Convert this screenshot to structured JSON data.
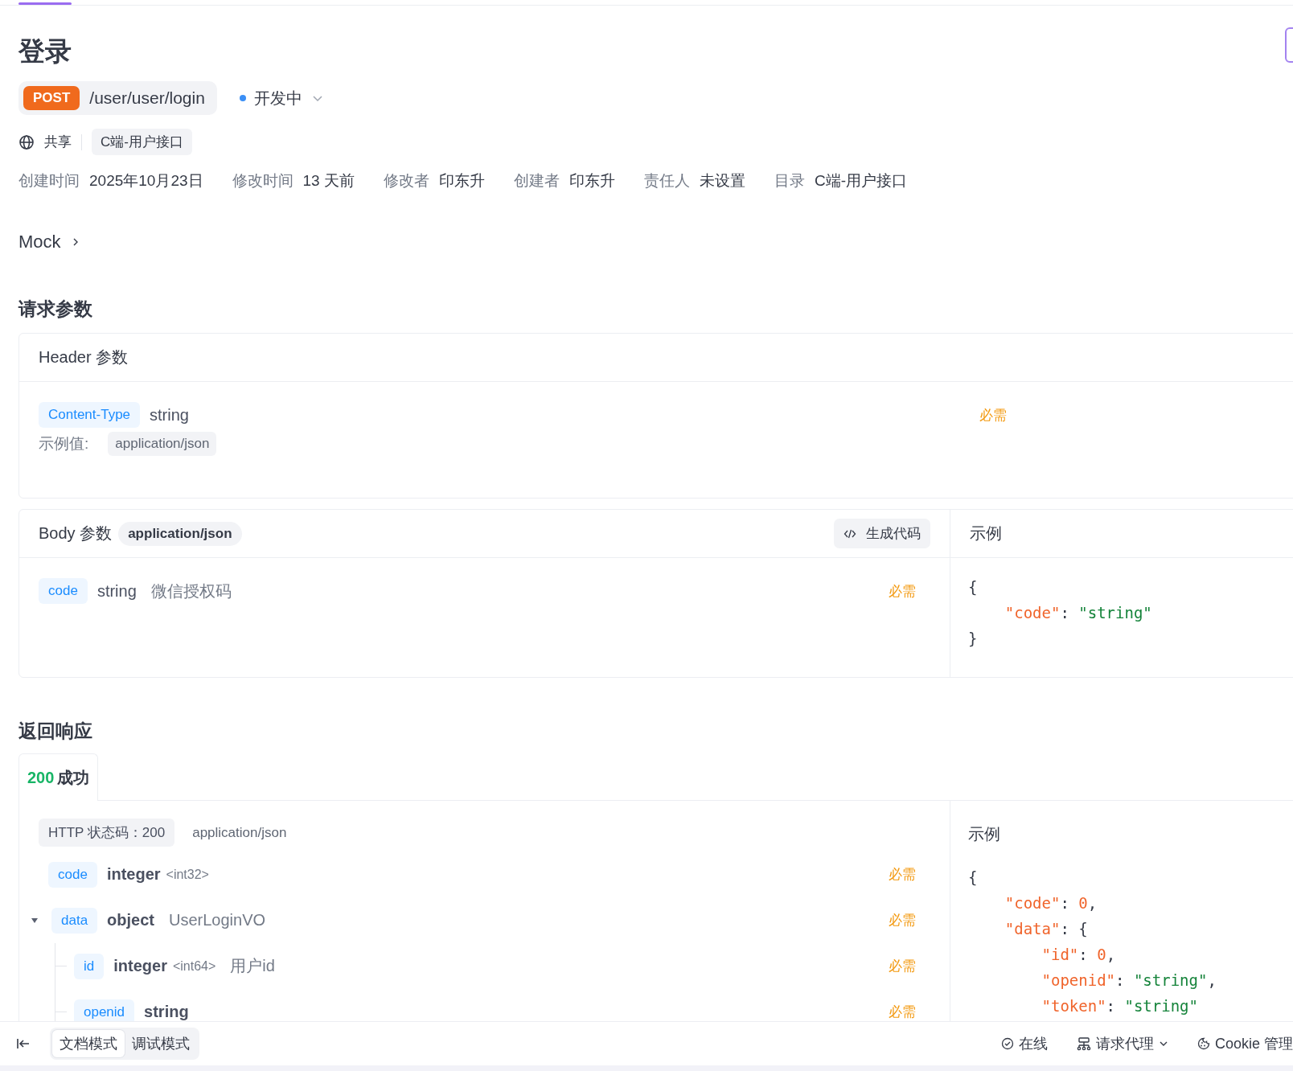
{
  "title": "登录",
  "method": "POST",
  "path": "/user/user/login",
  "status": {
    "label": "开发中",
    "color": "#3b8ff6"
  },
  "share": "共享",
  "folder_tag": "C端-用户接口",
  "meta": [
    {
      "label": "创建时间",
      "value": "2025年10月23日"
    },
    {
      "label": "修改时间",
      "value": "13 天前"
    },
    {
      "label": "修改者",
      "value": "印东升"
    },
    {
      "label": "创建者",
      "value": "印东升"
    },
    {
      "label": "责任人",
      "value": "未设置"
    },
    {
      "label": "目录",
      "value": "C端-用户接口"
    }
  ],
  "mock": {
    "label": "Mock",
    "expanded": false
  },
  "request": {
    "title": "请求参数",
    "header": {
      "title": "Header 参数",
      "params": [
        {
          "name": "Content-Type",
          "type": "string",
          "required": "必需",
          "example_label": "示例值:",
          "example": "application/json"
        }
      ]
    },
    "body": {
      "title": "Body 参数",
      "content_type": "application/json",
      "generate_button": "生成代码",
      "example_title": "示例",
      "params": [
        {
          "name": "code",
          "type": "string",
          "description": "微信授权码",
          "required": "必需"
        }
      ],
      "example": [
        [
          {
            "kind": "punct",
            "text": "{"
          }
        ],
        [
          {
            "kind": "key",
            "text": "    \"code\""
          },
          {
            "kind": "punct",
            "text": ": "
          },
          {
            "kind": "string",
            "text": "\"string\""
          }
        ],
        [
          {
            "kind": "punct",
            "text": "}"
          }
        ]
      ]
    }
  },
  "response": {
    "title": "返回响应",
    "tabs": [
      {
        "code": "200",
        "label": "成功",
        "selected": true
      }
    ],
    "http_status": "HTTP 状态码：200",
    "content_type": "application/json",
    "example_title": "示例",
    "fields": [
      {
        "name": "code",
        "type": "integer",
        "format": "<int32>",
        "required": "必需"
      },
      {
        "name": "data",
        "type": "object",
        "description": "UserLoginVO",
        "required": "必需",
        "expanded": true,
        "children": [
          {
            "name": "id",
            "type": "integer",
            "format": "<int64>",
            "description": "用户id",
            "required": "必需"
          },
          {
            "name": "openid",
            "type": "string",
            "required": "必需"
          }
        ]
      }
    ],
    "example": [
      [
        {
          "kind": "punct",
          "text": "{"
        }
      ],
      [
        {
          "kind": "key",
          "text": "    \"code\""
        },
        {
          "kind": "punct",
          "text": ": "
        },
        {
          "kind": "number",
          "text": "0"
        },
        {
          "kind": "punct",
          "text": ","
        }
      ],
      [
        {
          "kind": "key",
          "text": "    \"data\""
        },
        {
          "kind": "punct",
          "text": ": {"
        }
      ],
      [
        {
          "kind": "key",
          "text": "        \"id\""
        },
        {
          "kind": "punct",
          "text": ": "
        },
        {
          "kind": "number",
          "text": "0"
        },
        {
          "kind": "punct",
          "text": ","
        }
      ],
      [
        {
          "kind": "key",
          "text": "        \"openid\""
        },
        {
          "kind": "punct",
          "text": ": "
        },
        {
          "kind": "string",
          "text": "\"string\""
        },
        {
          "kind": "punct",
          "text": ","
        }
      ],
      [
        {
          "kind": "key",
          "text": "        \"token\""
        },
        {
          "kind": "punct",
          "text": ": "
        },
        {
          "kind": "string",
          "text": "\"string\""
        }
      ]
    ]
  },
  "bottom_bar": {
    "modes": [
      {
        "label": "文档模式",
        "selected": true
      },
      {
        "label": "调试模式",
        "selected": false
      }
    ],
    "online": "在线",
    "proxy": "请求代理",
    "cookie": "Cookie 管理"
  }
}
